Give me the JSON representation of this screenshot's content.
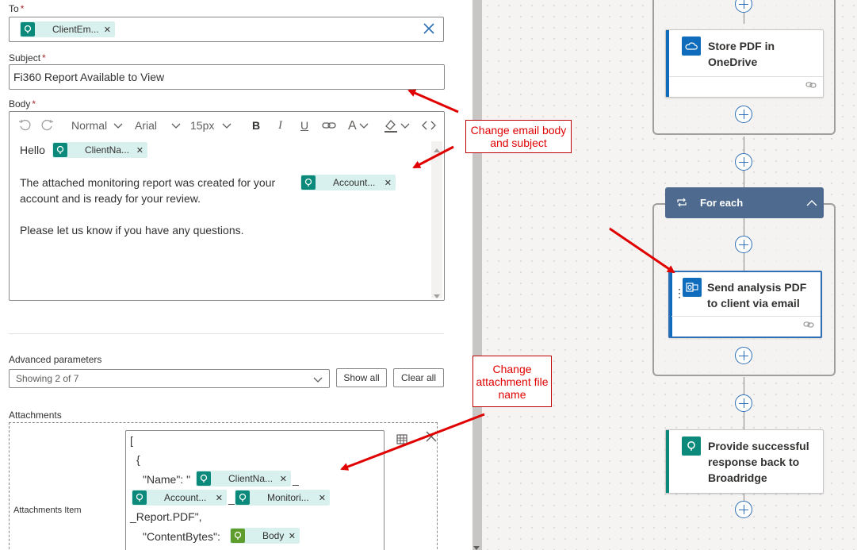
{
  "form": {
    "to_label": "To",
    "to_token": "ClientEm...",
    "subject_label": "Subject",
    "subject_value": "Fi360 Report Available to View",
    "body_label": "Body",
    "required_mark": "*",
    "toolbar": {
      "format": "Normal",
      "font": "Arial",
      "size": "15px",
      "bold": "B",
      "italic": "I",
      "underline": "U",
      "text_color": "A"
    },
    "body": {
      "hello": "Hello",
      "client_token": "ClientNa...",
      "line2a": "The attached monitoring report was created for your",
      "account_token": "Account...",
      "line2b": "account and is ready for your review.",
      "line3": "Please let us know if you have any questions."
    },
    "advanced_label": "Advanced parameters",
    "advanced_select": "Showing 2 of 7",
    "show_all": "Show all",
    "clear_all": "Clear all",
    "attachments_label": "Attachments",
    "attachments_item_label": "Attachments Item",
    "code": {
      "open_bracket": "[",
      "open_brace": "{",
      "name_key": "\"Name\": \"",
      "client_token": "ClientNa...",
      "underscore1": "_",
      "account_token": "Account...",
      "underscore2": "_",
      "monitor_token": "Monitori...",
      "report_suffix": "_Report.PDF\",",
      "content_key": "\"ContentBytes\":",
      "body_token": "Body"
    }
  },
  "flow": {
    "store_pdf": "Store PDF in OneDrive",
    "for_each": "For each",
    "send_email": "Send analysis PDF to client via email",
    "provide_response": "Provide successful response back to Broadridge"
  },
  "annotations": {
    "email_note": "Change email body and subject",
    "attachment_note": "Change attachment file name"
  },
  "colors": {
    "outlook_blue": "#0f6cbd",
    "onedrive_blue": "#0f6cbd",
    "request_teal": "#0b8a7c",
    "foreach_header": "#4e6b8f",
    "annotation_red": "#e00000"
  }
}
